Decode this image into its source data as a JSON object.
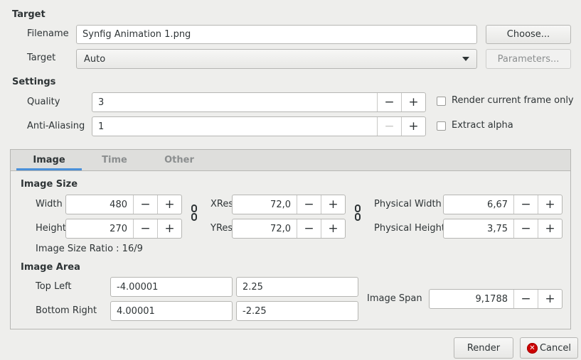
{
  "target": {
    "title": "Target",
    "filename_label": "Filename",
    "filename_value": "Synfig Animation 1.png",
    "choose_label": "Choose...",
    "target_label": "Target",
    "target_value": "Auto",
    "parameters_label": "Parameters..."
  },
  "settings": {
    "title": "Settings",
    "quality_label": "Quality",
    "quality_value": "3",
    "antialiasing_label": "Anti-Aliasing",
    "antialiasing_value": "1",
    "render_current_frame_label": "Render current frame only",
    "extract_alpha_label": "Extract alpha",
    "minus": "−",
    "plus": "+"
  },
  "tabs": [
    {
      "label": "Image",
      "active": true
    },
    {
      "label": "Time",
      "active": false
    },
    {
      "label": "Other",
      "active": false
    }
  ],
  "image_size": {
    "title": "Image Size",
    "width_label": "Width",
    "width_value": "480",
    "height_label": "Height",
    "height_value": "270",
    "xres_label": "XRes",
    "xres_value": "72,0",
    "yres_label": "YRes",
    "yres_value": "72,0",
    "physical_width_label": "Physical Width",
    "physical_width_value": "6,67",
    "physical_height_label": "Physical Height",
    "physical_height_value": "3,75",
    "ratio_text": "Image Size Ratio : 16/9"
  },
  "image_area": {
    "title": "Image Area",
    "top_left_label": "Top Left",
    "top_left_x": "-4.00001",
    "top_left_y": "2.25",
    "bottom_right_label": "Bottom Right",
    "bottom_right_x": "4.00001",
    "bottom_right_y": "-2.25",
    "image_span_label": "Image Span",
    "image_span_value": "9,1788"
  },
  "footer": {
    "render_label": "Render",
    "cancel_label": "Cancel"
  },
  "colors": {
    "background": "#eeeeec",
    "accent": "#4a90d9",
    "cancel_icon": "#cc0000"
  }
}
